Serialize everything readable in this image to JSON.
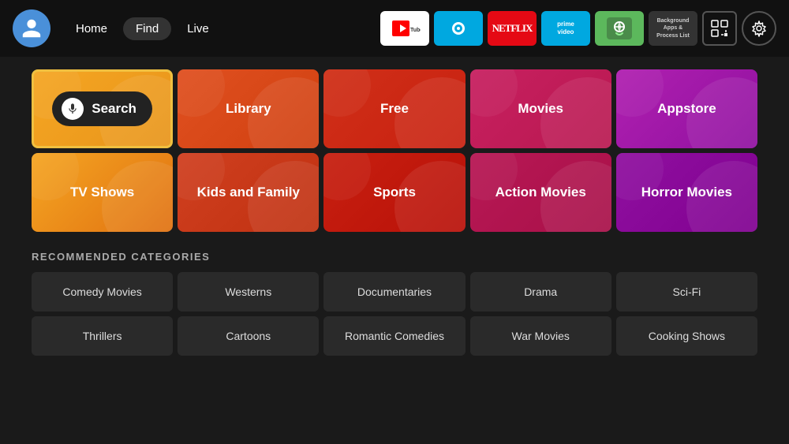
{
  "header": {
    "nav": [
      {
        "id": "home",
        "label": "Home",
        "active": false
      },
      {
        "id": "find",
        "label": "Find",
        "active": true
      },
      {
        "id": "live",
        "label": "Live",
        "active": false
      }
    ],
    "apps": [
      {
        "id": "youtube",
        "label": "YouTube",
        "style": "youtube"
      },
      {
        "id": "prime-circle",
        "label": "",
        "style": "prime"
      },
      {
        "id": "netflix",
        "label": "NETFLIX",
        "style": "netflix"
      },
      {
        "id": "prime-video",
        "label": "prime video",
        "style": "primevideo"
      },
      {
        "id": "vpn",
        "label": "",
        "style": "vpn"
      },
      {
        "id": "background",
        "label": "Background Apps & Process List",
        "style": "background"
      }
    ]
  },
  "tiles": {
    "search_label": "Search",
    "tv_shows_label": "TV Shows",
    "library_label": "Library",
    "kids_label": "Kids and Family",
    "free_label": "Free",
    "sports_label": "Sports",
    "movies_label": "Movies",
    "action_label": "Action Movies",
    "appstore_label": "Appstore",
    "horror_label": "Horror Movies"
  },
  "recommended": {
    "section_title": "RECOMMENDED CATEGORIES",
    "items": [
      "Comedy Movies",
      "Westerns",
      "Documentaries",
      "Drama",
      "Sci-Fi",
      "Thrillers",
      "Cartoons",
      "Romantic Comedies",
      "War Movies",
      "Cooking Shows"
    ]
  }
}
